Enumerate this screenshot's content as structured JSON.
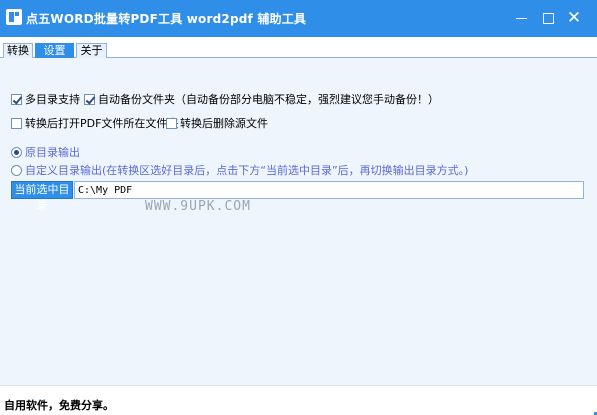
{
  "window": {
    "title": "点五WORD批量转PDF工具 word2pdf 辅助工具",
    "minimize_glyph": "—",
    "maximize_glyph": "☐",
    "close_glyph": "✕"
  },
  "tabs": [
    {
      "label": "转换",
      "active": false
    },
    {
      "label": "设置",
      "active": true
    },
    {
      "label": "关于",
      "active": false
    }
  ],
  "options": {
    "multi_dir": {
      "label": "多目录支持",
      "checked": true
    },
    "auto_backup": {
      "label": "自动备份文件夹（自动备份部分电脑不稳定，强烈建议您手动备份！）",
      "checked": true
    },
    "open_folder_after": {
      "label": "转换后打开PDF文件所在文件夹",
      "checked": false
    },
    "delete_source_after": {
      "label": "转换后删除源文件",
      "checked": false
    }
  },
  "output_mode": {
    "original": {
      "label": "原目录输出",
      "selected": true
    },
    "custom": {
      "label": "自定义目录输出(在转换区选好目录后，点击下方“当前选中目录”后，再切换输出目录方式。)",
      "selected": false
    }
  },
  "directory": {
    "button_label": "当前选中目录",
    "path_value": "C:\\My PDF"
  },
  "watermark": "WWW.9UPK.COM",
  "status": {
    "text": "自用软件，免费分享。"
  },
  "colors": {
    "accent": "#2f8ee7",
    "radio_text": "#5b6bd5"
  }
}
